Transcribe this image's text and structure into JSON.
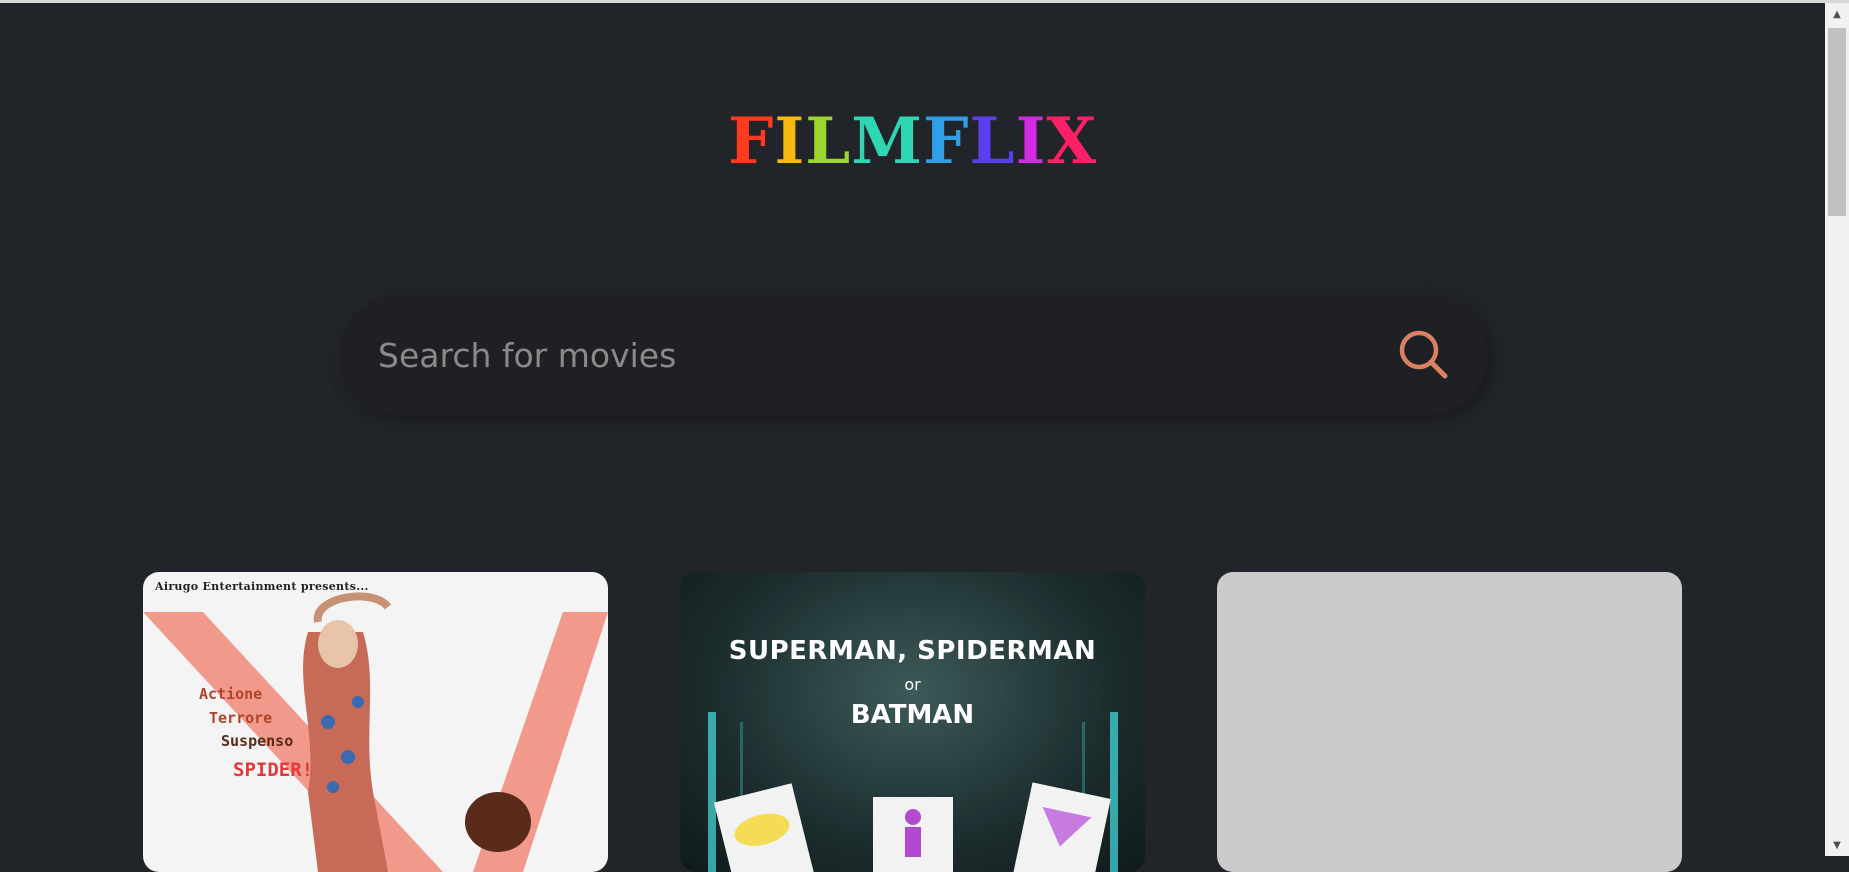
{
  "app": {
    "logo_letters": [
      {
        "char": "F",
        "color": "#ff3a1f"
      },
      {
        "char": "I",
        "color": "#f5b90f"
      },
      {
        "char": "L",
        "color": "#9ad62e"
      },
      {
        "char": "M",
        "color": "#2fd6b4"
      },
      {
        "char": "F",
        "color": "#2f9fe8"
      },
      {
        "char": "L",
        "color": "#5a3ef0"
      },
      {
        "char": "I",
        "color": "#d22be3"
      },
      {
        "char": "X",
        "color": "#ff1f66"
      }
    ]
  },
  "search": {
    "placeholder": "Search for movies",
    "value": "",
    "icon": "search-icon",
    "icon_color": "#d98262"
  },
  "movies": [
    {
      "poster_texts": {
        "presenter": "Airugo Entertainment presents...",
        "line1": "Actione",
        "line2": "Terrore",
        "line3": "Suspenso",
        "line4": "SPIDER!"
      }
    },
    {
      "poster_texts": {
        "line1": "SUPERMAN, SPIDERMAN",
        "line2": "or",
        "line3": "BATMAN"
      }
    },
    {
      "poster_texts": {}
    }
  ],
  "colors": {
    "background": "#212428",
    "search_bg": "#1f2023",
    "placeholder": "#8a8a8a"
  }
}
